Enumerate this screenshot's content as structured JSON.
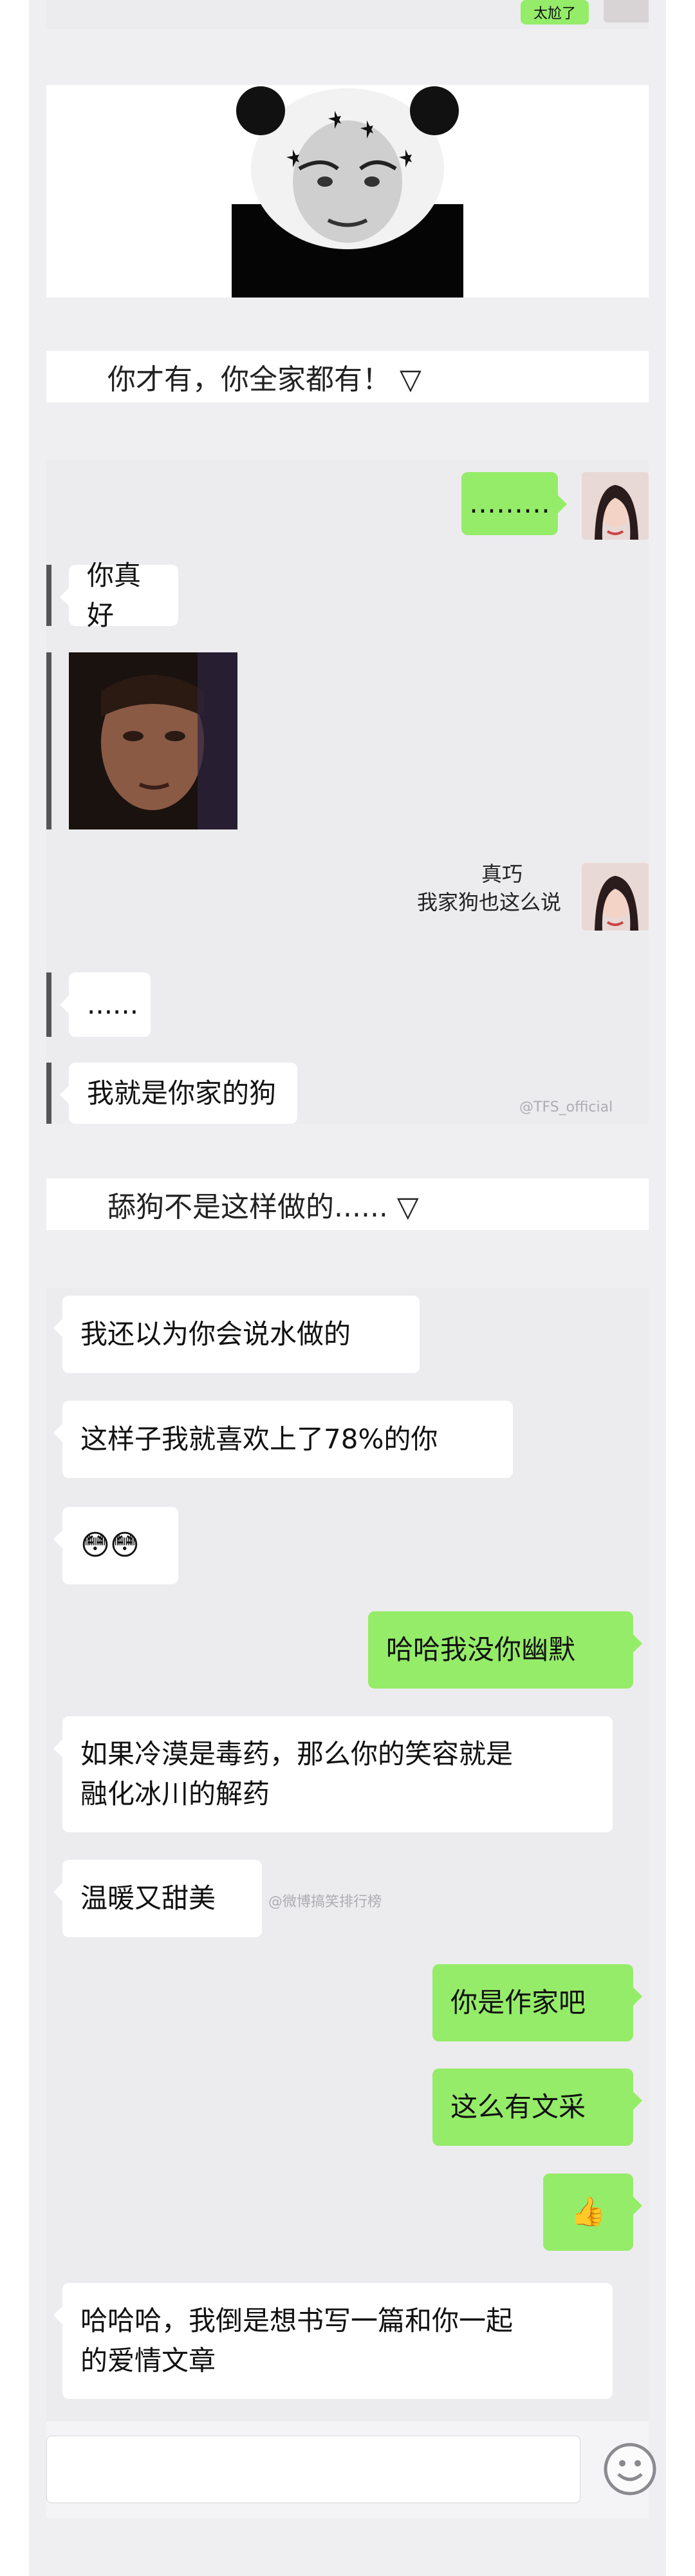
{
  "section1": {
    "bubble_text": "太尬了"
  },
  "captions": {
    "first": "你才有，你全家都有！ ▽",
    "second": "舔狗不是这样做的...... ▽"
  },
  "chat1": {
    "messages": [
      {
        "side": "right",
        "text": "………"
      },
      {
        "side": "left",
        "text": "你真好"
      },
      {
        "side": "right",
        "line1": "真巧",
        "line2": "我家狗也这么说"
      },
      {
        "side": "left",
        "text": "......"
      },
      {
        "side": "left",
        "text": "我就是你家的狗"
      }
    ],
    "watermark": "@TFS_official"
  },
  "chat2": {
    "messages": [
      {
        "side": "left",
        "text": "我还以为你会说水做的"
      },
      {
        "side": "left",
        "text": "这样子我就喜欢上了78%的你"
      },
      {
        "side": "left",
        "text": "😳😳"
      },
      {
        "side": "right",
        "text": "哈哈我没你幽默"
      },
      {
        "side": "left",
        "line1": "如果冷漠是毒药，那么你的笑容就是",
        "line2": "融化冰川的解药"
      },
      {
        "side": "left",
        "text": "温暖又甜美"
      },
      {
        "side": "right",
        "text": "你是作家吧"
      },
      {
        "side": "right",
        "text": "这么有文采"
      },
      {
        "side": "right",
        "text": "👍"
      },
      {
        "side": "left",
        "line1": "哈哈哈，我倒是想书写一篇和你一起",
        "line2": "的爱情文章"
      }
    ],
    "watermark": "@微博搞笑排行榜"
  },
  "input_bar": {
    "placeholder": "",
    "emoji_icon": "smile-icon"
  }
}
